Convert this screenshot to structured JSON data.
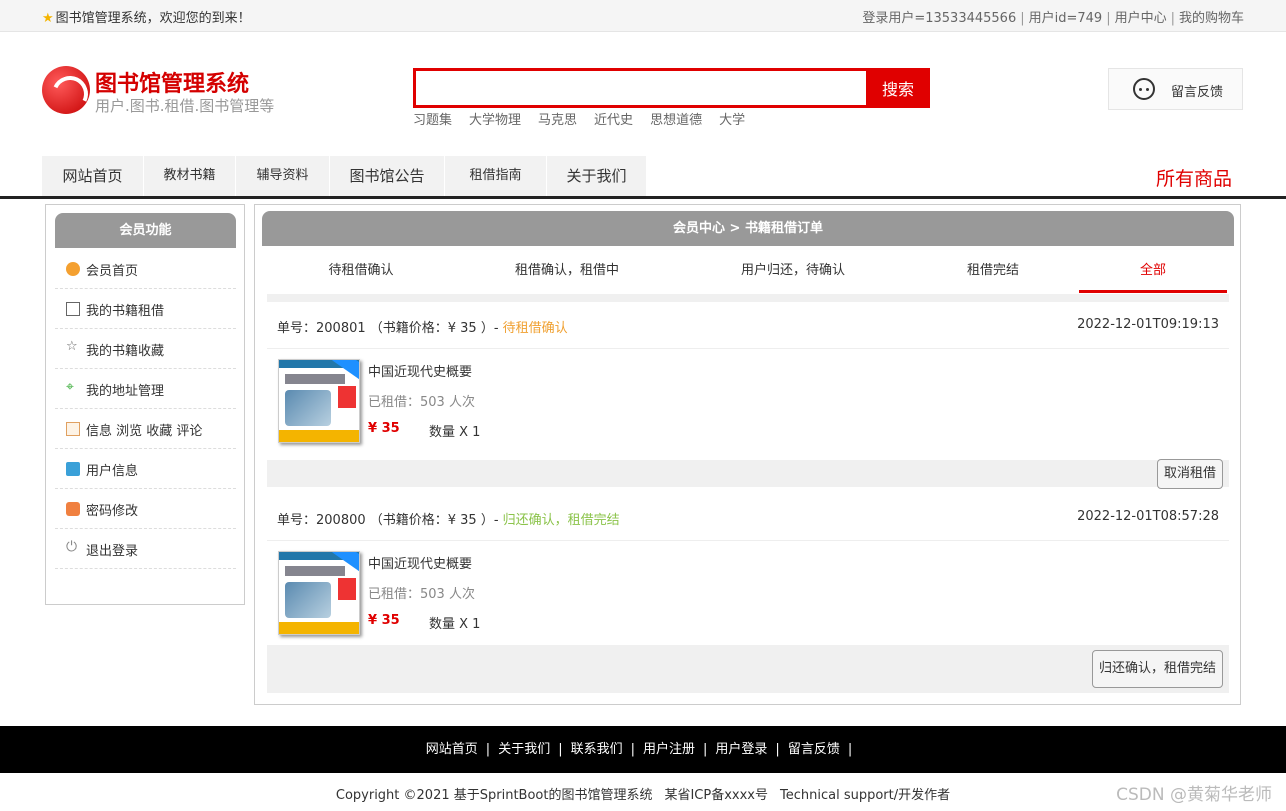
{
  "topbar": {
    "welcome": "图书馆管理系统，欢迎您的到来！",
    "login_user": "登录用户=13533445566",
    "user_id": "用户id=749",
    "member_center": "用户中心",
    "cart": "我的购物车",
    "sep": "|"
  },
  "header": {
    "logo_title": "图书馆管理系统",
    "logo_sub": "用户.图书.租借.图书管理等",
    "search_placeholder": "",
    "search_button": "搜索",
    "hot_keywords": [
      "习题集",
      "大学物理",
      "马克思",
      "近代史",
      "思想道德",
      "大学"
    ],
    "feedback": "留言反馈"
  },
  "nav": {
    "items": [
      "网站首页",
      "教材书籍",
      "辅导资料",
      "图书馆公告",
      "租借指南",
      "关于我们"
    ],
    "right_label": "所有商品"
  },
  "sidebar": {
    "title": "会员功能",
    "items": [
      "会员首页",
      "我的书籍租借",
      "我的书籍收藏",
      "我的地址管理",
      "信息 浏览 收藏 评论",
      "用户信息",
      "密码修改",
      "退出登录"
    ]
  },
  "main": {
    "title": "会员中心 > 书籍租借订单",
    "tabs": [
      "待租借确认",
      "租借确认，租借中",
      "用户归还，待确认",
      "租借完结",
      "全部"
    ],
    "active_tab": "全部",
    "orders": [
      {
        "prefix": "单号：200801 （书籍价格：¥ 35 ）- ",
        "status": "待租借确认",
        "time": "2022-12-01T09:19:13",
        "book_name": "中国近现代史概要",
        "rent_count": "已租借：503 人次",
        "price": "¥ 35",
        "qty": "数量 X 1",
        "action": "取消租借"
      },
      {
        "prefix": "单号：200800 （书籍价格：¥ 35 ）- ",
        "status": "归还确认，租借完结",
        "time": "2022-12-01T08:57:28",
        "book_name": "中国近现代史概要",
        "rent_count": "已租借：503 人次",
        "price": "¥ 35",
        "qty": "数量 X 1",
        "action": "归还确认，租借完结"
      }
    ]
  },
  "footer": {
    "links": [
      "网站首页",
      "关于我们",
      "联系我们",
      "用户注册",
      "用户登录",
      "留言反馈"
    ],
    "copyright": "Copyright ©2021 基于SprintBoot的图书馆管理系统",
    "icp": "某省ICP备xxxx号",
    "support": "Technical support/开发作者",
    "watermark": "CSDN @黄菊华老师"
  },
  "colors": {
    "accent": "#e00000",
    "status_wait": "#f0a030",
    "status_done": "#8bc34a",
    "panel_head": "#999999"
  }
}
